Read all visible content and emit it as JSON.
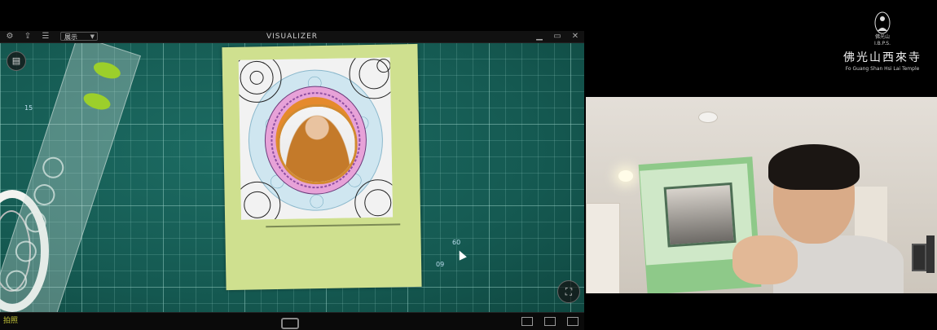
{
  "visualizer": {
    "title": "VISUALIZER",
    "view_mode": "展示",
    "capture_label": "拍照",
    "toolbar_icons": [
      "gear-icon",
      "export-icon",
      "list-icon"
    ],
    "window_icons": [
      "minimize-icon",
      "restore-icon",
      "close-icon"
    ]
  },
  "camera_feed": {
    "ruler_numbers": [
      "15",
      "60",
      "09"
    ]
  },
  "temple_logo": {
    "small_text": "佛光山\nI.B.P.S.",
    "chinese_name": "佛光山西來寺",
    "english_name": "Fo Guang Shan Hsi Lai Temple"
  },
  "colors": {
    "cutting_mat": "#155a52",
    "card_green": "#cfe08f",
    "capture_label": "#c8c83a"
  }
}
